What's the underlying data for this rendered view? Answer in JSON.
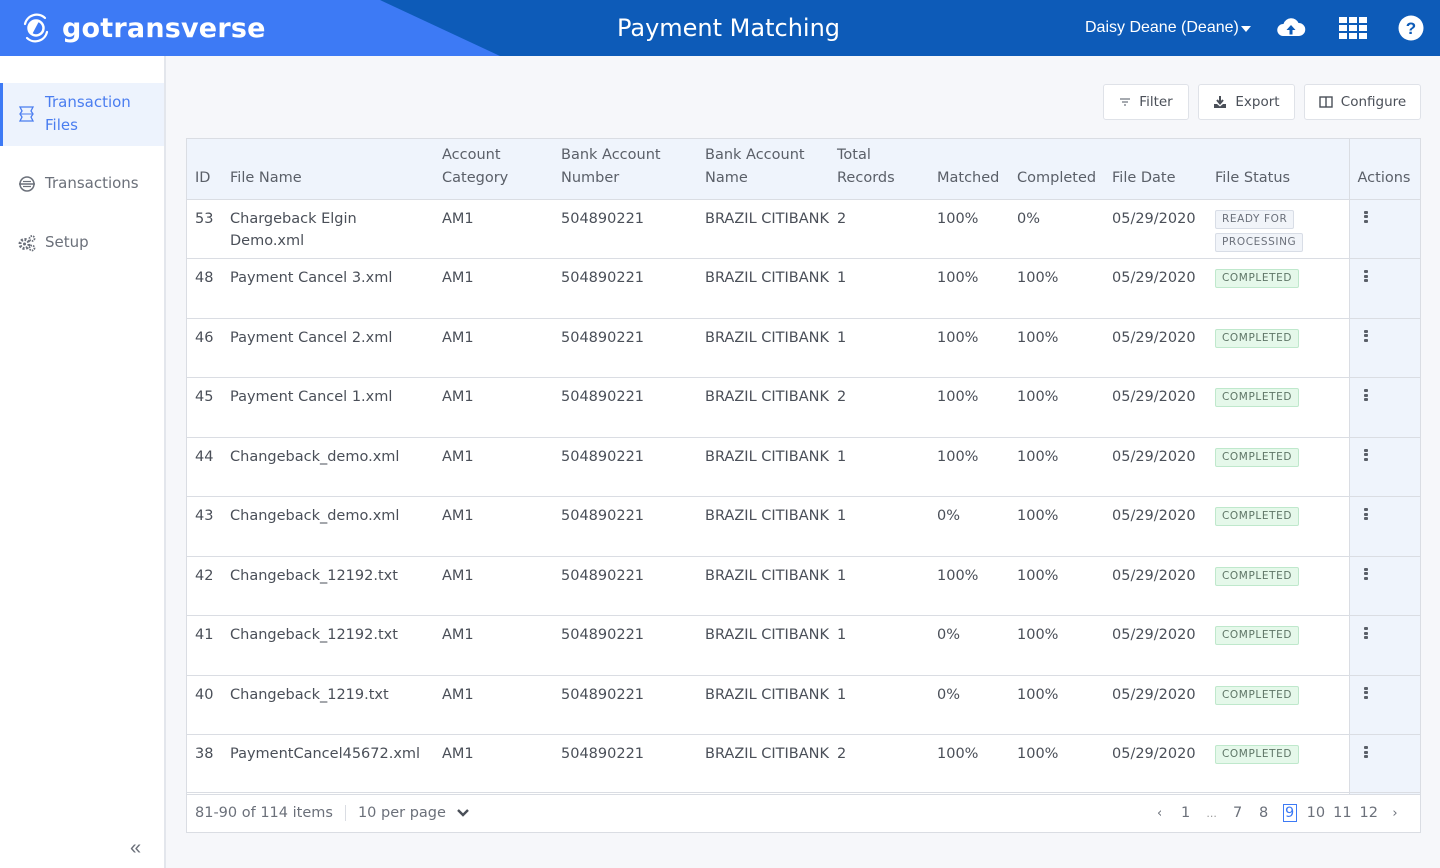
{
  "header": {
    "brand": "gotransverse",
    "title": "Payment Matching",
    "user": "Daisy Deane (Deane)",
    "icons": [
      "cloud-upload-icon",
      "apps-grid-icon",
      "help-icon"
    ]
  },
  "sidebar": {
    "items": [
      {
        "label": "Transaction Files",
        "icon": "file-stack-icon",
        "active": true
      },
      {
        "label": "Transactions",
        "icon": "transactions-icon",
        "active": false
      },
      {
        "label": "Setup",
        "icon": "gears-icon",
        "active": false
      }
    ],
    "collapse_label": "«"
  },
  "toolbar": {
    "filter_label": "Filter",
    "export_label": "Export",
    "configure_label": "Configure"
  },
  "table": {
    "columns": {
      "id": "ID",
      "file_name": "File Name",
      "account_category": "Account Category",
      "bank_account_number": "Bank Account Number",
      "bank_account_name": "Bank Account Name",
      "total_records": "Total Records",
      "matched": "Matched",
      "completed": "Completed",
      "file_date": "File Date",
      "file_status": "File Status",
      "actions": "Actions"
    },
    "rows": [
      {
        "id": "53",
        "file_name": "Chargeback Elgin Demo.xml",
        "account_category": "AM1",
        "bank_account_number": "504890221",
        "bank_account_name": "BRAZIL CITIBANK",
        "total_records": "2",
        "matched": "100%",
        "completed": "0%",
        "file_date": "05/29/2020",
        "status_lines": [
          "READY FOR",
          "PROCESSING"
        ],
        "status_type": "ready"
      },
      {
        "id": "48",
        "file_name": "Payment Cancel 3.xml",
        "account_category": "AM1",
        "bank_account_number": "504890221",
        "bank_account_name": "BRAZIL CITIBANK",
        "total_records": "1",
        "matched": "100%",
        "completed": "100%",
        "file_date": "05/29/2020",
        "status_lines": [
          "COMPLETED"
        ],
        "status_type": "completed"
      },
      {
        "id": "46",
        "file_name": "Payment Cancel 2.xml",
        "account_category": "AM1",
        "bank_account_number": "504890221",
        "bank_account_name": "BRAZIL CITIBANK",
        "total_records": "1",
        "matched": "100%",
        "completed": "100%",
        "file_date": "05/29/2020",
        "status_lines": [
          "COMPLETED"
        ],
        "status_type": "completed"
      },
      {
        "id": "45",
        "file_name": "Payment Cancel 1.xml",
        "account_category": "AM1",
        "bank_account_number": "504890221",
        "bank_account_name": "BRAZIL CITIBANK",
        "total_records": "2",
        "matched": "100%",
        "completed": "100%",
        "file_date": "05/29/2020",
        "status_lines": [
          "COMPLETED"
        ],
        "status_type": "completed"
      },
      {
        "id": "44",
        "file_name": "Changeback_demo.xml",
        "account_category": "AM1",
        "bank_account_number": "504890221",
        "bank_account_name": "BRAZIL CITIBANK",
        "total_records": "1",
        "matched": "100%",
        "completed": "100%",
        "file_date": "05/29/2020",
        "status_lines": [
          "COMPLETED"
        ],
        "status_type": "completed"
      },
      {
        "id": "43",
        "file_name": "Changeback_demo.xml",
        "account_category": "AM1",
        "bank_account_number": "504890221",
        "bank_account_name": "BRAZIL CITIBANK",
        "total_records": "1",
        "matched": "0%",
        "completed": "100%",
        "file_date": "05/29/2020",
        "status_lines": [
          "COMPLETED"
        ],
        "status_type": "completed"
      },
      {
        "id": "42",
        "file_name": "Changeback_12192.txt",
        "account_category": "AM1",
        "bank_account_number": "504890221",
        "bank_account_name": "BRAZIL CITIBANK",
        "total_records": "1",
        "matched": "100%",
        "completed": "100%",
        "file_date": "05/29/2020",
        "status_lines": [
          "COMPLETED"
        ],
        "status_type": "completed"
      },
      {
        "id": "41",
        "file_name": "Changeback_12192.txt",
        "account_category": "AM1",
        "bank_account_number": "504890221",
        "bank_account_name": "BRAZIL CITIBANK",
        "total_records": "1",
        "matched": "0%",
        "completed": "100%",
        "file_date": "05/29/2020",
        "status_lines": [
          "COMPLETED"
        ],
        "status_type": "completed"
      },
      {
        "id": "40",
        "file_name": "Changeback_1219.txt",
        "account_category": "AM1",
        "bank_account_number": "504890221",
        "bank_account_name": "BRAZIL CITIBANK",
        "total_records": "1",
        "matched": "0%",
        "completed": "100%",
        "file_date": "05/29/2020",
        "status_lines": [
          "COMPLETED"
        ],
        "status_type": "completed"
      },
      {
        "id": "38",
        "file_name": "PaymentCancel45672.xml",
        "account_category": "AM1",
        "bank_account_number": "504890221",
        "bank_account_name": "BRAZIL CITIBANK",
        "total_records": "2",
        "matched": "100%",
        "completed": "100%",
        "file_date": "05/29/2020",
        "status_lines": [
          "COMPLETED"
        ],
        "status_type": "completed"
      }
    ]
  },
  "pager": {
    "summary": "81-90 of 114 items",
    "per_page": "10 per page",
    "prev": "‹",
    "next": "›",
    "pages": [
      "1",
      "...",
      "7",
      "8",
      "9",
      "10",
      "11",
      "12"
    ],
    "current": "9"
  },
  "colors": {
    "header_dark": "#0d5bb8",
    "header_brand": "#3d7af5",
    "accent": "#3d7af5",
    "completed_bg": "#e5f8ea"
  }
}
